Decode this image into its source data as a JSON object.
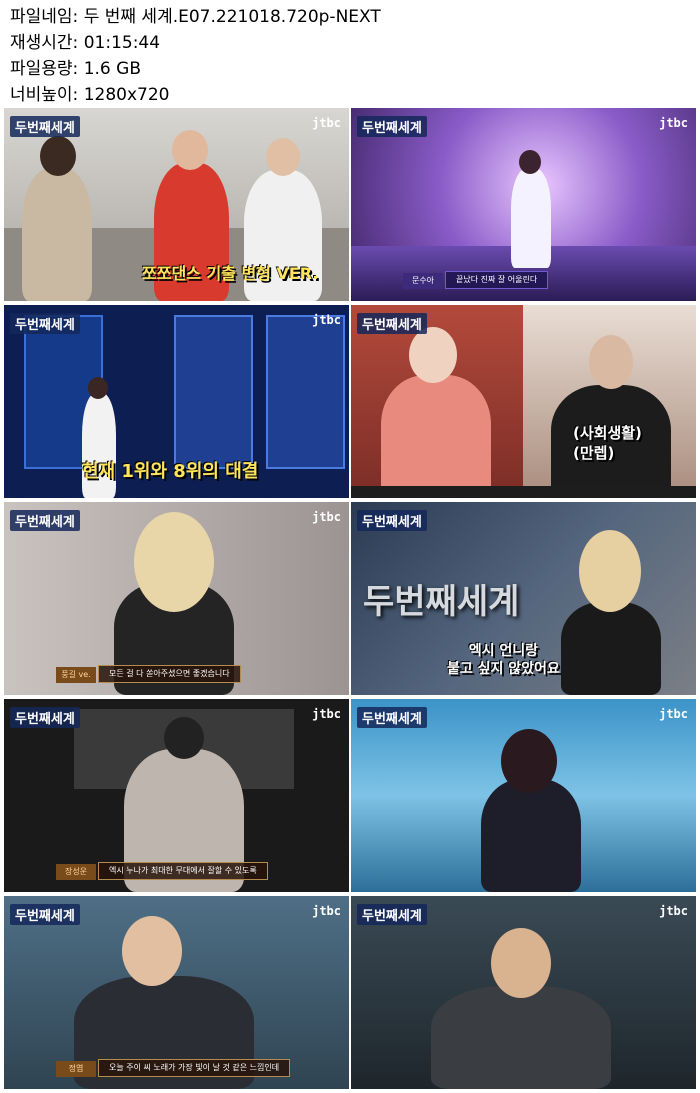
{
  "meta": {
    "rows": [
      {
        "label": "파일네임:",
        "value": "두 번째 세계.E07.221018.720p-NEXT"
      },
      {
        "label": "재생시간:",
        "value": "01:15:44"
      },
      {
        "label": "파일용량:",
        "value": "1.6 GB"
      },
      {
        "label": "너비높이:",
        "value": "1280x720"
      }
    ]
  },
  "logo": "두번째세계",
  "broadcaster": "jtbc",
  "thumbs": [
    {
      "caption": "쪼쪼댄스 기출 변형 VER.",
      "subtitle": ""
    },
    {
      "caption": "",
      "subtitle": "끝났다 진짜 잘 어울린다",
      "name": "문수아"
    },
    {
      "caption": "현재 1위와 8위의 대결",
      "subtitle": ""
    },
    {
      "caption": "(사회생활)\n(만렙)",
      "subtitle": ""
    },
    {
      "caption": "",
      "subtitle": "모든 걸 다 쏟아주셨으면 좋겠습니다",
      "name": "풍길 ve."
    },
    {
      "caption": "엑시 언니랑\n붙고 싶지 않았어요",
      "subtitle": ""
    },
    {
      "caption": "",
      "subtitle": "엑시 누나가 최대한 무대에서 잘할 수 있도록",
      "name": "장성운"
    },
    {
      "caption": "",
      "subtitle": "",
      "name": ""
    },
    {
      "caption": "",
      "subtitle": "오늘 주이 씨 노래가 가장 빛이 날 것 같은 느낌인데",
      "name": "정엽"
    },
    {
      "caption": "",
      "subtitle": ""
    }
  ]
}
